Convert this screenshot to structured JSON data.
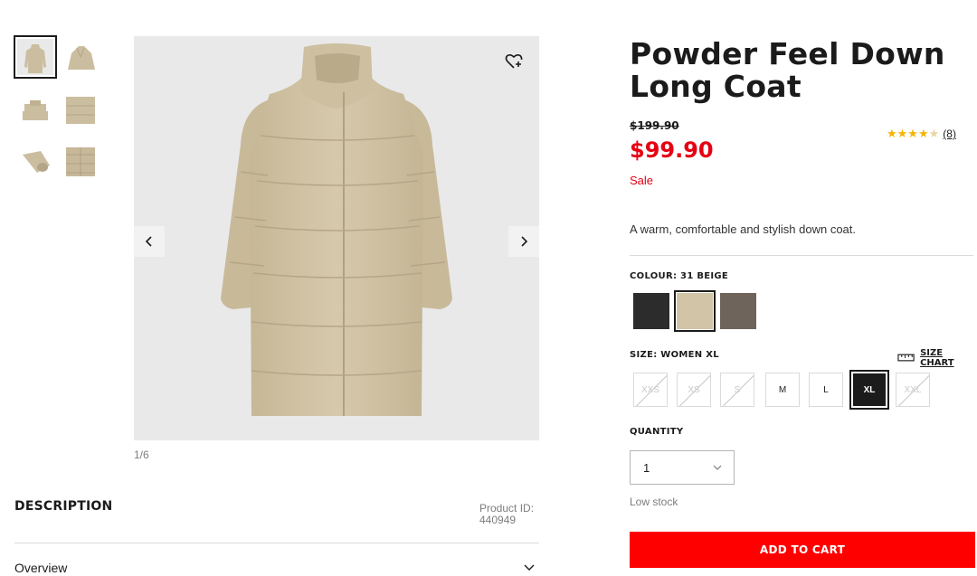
{
  "gallery": {
    "counter": "1/6",
    "thumbnails": [
      "thumb-1",
      "thumb-2",
      "thumb-3",
      "thumb-4",
      "thumb-5",
      "thumb-6"
    ],
    "wishlist_icon": "heart-plus-icon",
    "prev_icon": "chevron-left-icon",
    "next_icon": "chevron-right-icon"
  },
  "description": {
    "title": "DESCRIPTION",
    "product_id_label": "Product ID:",
    "product_id": "440949",
    "overview_label": "Overview"
  },
  "product": {
    "title_line1": "Powder Feel Down",
    "title_line2": "Long Coat",
    "original_price": "$199.90",
    "price": "$99.90",
    "sale_label": "Sale",
    "rating_stars": "★★★★★",
    "rating_value": 4.5,
    "review_count": "(8)",
    "tagline": "A warm, comfortable and stylish down coat."
  },
  "colour": {
    "label": "COLOUR: 31 BEIGE",
    "swatches": [
      {
        "name": "black",
        "color": "#2c2c2c",
        "selected": false
      },
      {
        "name": "beige",
        "color": "#d2c4a6",
        "selected": true
      },
      {
        "name": "brown",
        "color": "#6e645c",
        "selected": false
      }
    ]
  },
  "size": {
    "label": "SIZE: WOMEN XL",
    "chart_label": "SIZE CHART",
    "options": [
      {
        "label": "XXS",
        "available": false,
        "selected": false
      },
      {
        "label": "XS",
        "available": false,
        "selected": false
      },
      {
        "label": "S",
        "available": false,
        "selected": false
      },
      {
        "label": "M",
        "available": true,
        "selected": false
      },
      {
        "label": "L",
        "available": true,
        "selected": false
      },
      {
        "label": "XL",
        "available": true,
        "selected": true
      },
      {
        "label": "XXL",
        "available": false,
        "selected": false
      }
    ]
  },
  "quantity": {
    "label": "QUANTITY",
    "value": "1",
    "stock_note": "Low stock"
  },
  "cart": {
    "button_label": "ADD TO CART",
    "button_color": "#ff0000"
  },
  "colors": {
    "sale_red": "#e60012",
    "star_gold": "#f5b400",
    "coat_beige": "#d2c4a6",
    "image_bg": "#e9e9ea"
  }
}
